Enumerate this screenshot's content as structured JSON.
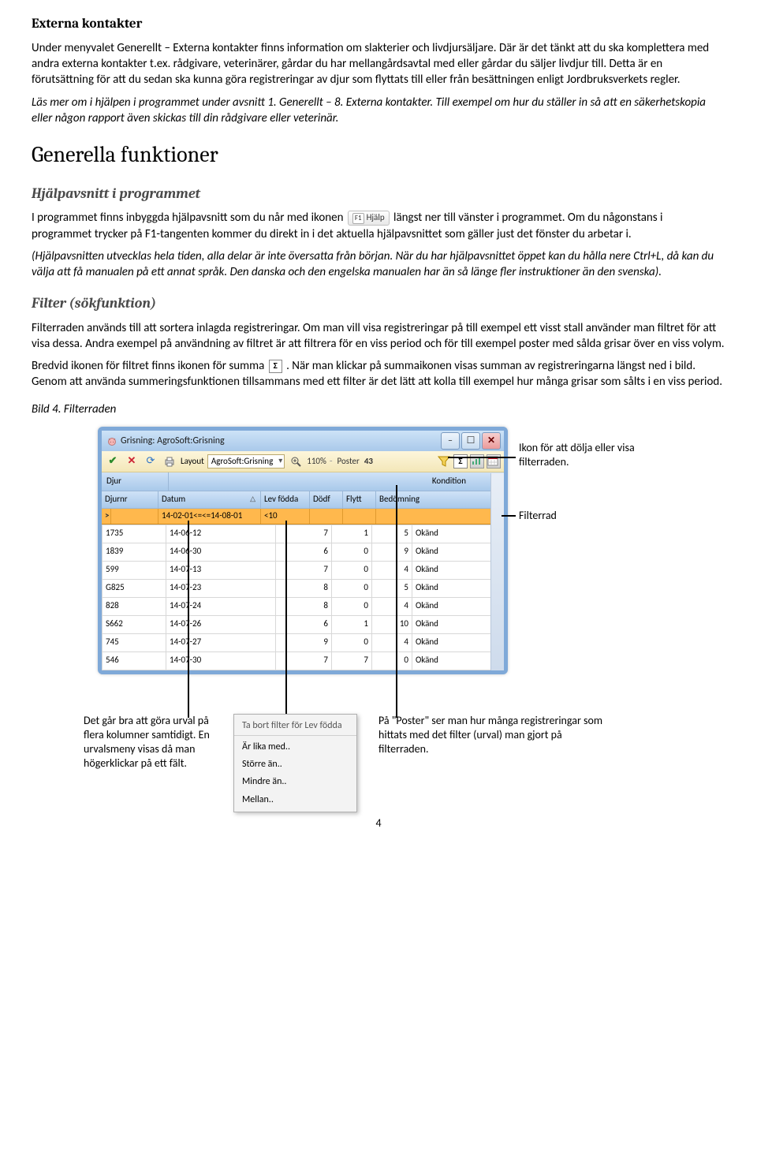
{
  "sections": {
    "h_externa": "Externa kontakter",
    "p1": "Under menyvalet Generellt – Externa kontakter finns information om slakterier och livdjursäljare. Där är det tänkt att du ska komplettera med andra externa kontakter t.ex. rådgivare, veterinärer, gårdar du har mellangårdsavtal med eller gårdar du säljer livdjur till. Detta är en förutsättning för att du sedan ska kunna göra registreringar av djur som flyttats till eller från besättningen enligt Jordbruksverkets regler.",
    "p2": "Läs mer om i hjälpen i programmet under avsnitt 1. Generellt – 8. Externa kontakter. Till exempel om hur du ställer in så att en säkerhetskopia eller någon rapport även skickas till din rådgivare eller veterinär.",
    "h_generella": "Generella funktioner",
    "h_hjalp": "Hjälpavsnitt i programmet",
    "p3a": "I programmet finns inbyggda hjälpavsnitt som du når med ikonen ",
    "p3b": " längst ner till vänster i programmet. Om du någonstans i programmet trycker på F1-tangenten kommer du direkt in i det aktuella hjälpavsnittet som gäller just det fönster du arbetar i.",
    "p4": "(Hjälpavsnitten utvecklas hela tiden, alla delar är inte översatta från början. När du har hjälpavsnittet öppet kan du hålla nere Ctrl+L, då kan du välja att få manualen på ett annat språk. Den danska och den engelska manualen har än så länge fler instruktioner än den svenska).",
    "h_filter": "Filter (sökfunktion)",
    "p5": "Filterraden används till att sortera inlagda registreringar. Om man vill visa registreringar på till exempel ett visst stall använder man filtret för att visa dessa. Andra exempel på användning av filtret är att filtrera för en viss period och för till exempel poster med sålda grisar över en viss volym.",
    "p6a": "Bredvid ikonen för filtret finns ikonen för summa ",
    "p6b": ". När man klickar på summaikonen visas summan av registreringarna längst ned i bild.  Genom att använda summeringsfunktionen tillsammans med ett filter är det lätt att kolla till exempel hur många grisar som sålts i en viss period.",
    "caption": "Bild 4. Filterraden"
  },
  "helpbtn": {
    "key": "F1",
    "label": "Hjälp"
  },
  "sigma_label": "Σ",
  "page": "4",
  "window": {
    "title": "Grisning: AgroSoft:Grisning",
    "toolbar": {
      "layout_label": "Layout",
      "layout_value": "AgroSoft:Grisning",
      "zoom": "110%",
      "poster_label": "Poster",
      "poster_value": "43"
    },
    "band1": {
      "djur": "Djur",
      "kond": "Kondition"
    },
    "headers": {
      "djurnr": "Djurnr",
      "datum": "Datum",
      "lev": "Lev födda",
      "dodf": "Dödf",
      "flytt": "Flytt",
      "bed": "Bedömning"
    },
    "filter": {
      "mark": ">",
      "datum": "14-02-01<=<=14-08-01",
      "lev": "<10"
    },
    "rows": [
      {
        "djurnr": "1735",
        "datum": "14-06-12",
        "lev": "7",
        "dodf": "1",
        "flytt": "5",
        "bed": "Okänd"
      },
      {
        "djurnr": "1839",
        "datum": "14-06-30",
        "lev": "6",
        "dodf": "0",
        "flytt": "9",
        "bed": "Okänd"
      },
      {
        "djurnr": "599",
        "datum": "14-07-13",
        "lev": "7",
        "dodf": "0",
        "flytt": "4",
        "bed": "Okänd"
      },
      {
        "djurnr": "G825",
        "datum": "14-07-23",
        "lev": "8",
        "dodf": "0",
        "flytt": "5",
        "bed": "Okänd"
      },
      {
        "djurnr": "828",
        "datum": "14-07-24",
        "lev": "8",
        "dodf": "0",
        "flytt": "4",
        "bed": "Okänd"
      },
      {
        "djurnr": "S662",
        "datum": "14-07-26",
        "lev": "6",
        "dodf": "1",
        "flytt": "10",
        "bed": "Okänd"
      },
      {
        "djurnr": "745",
        "datum": "14-07-27",
        "lev": "9",
        "dodf": "0",
        "flytt": "4",
        "bed": "Okänd"
      },
      {
        "djurnr": "546",
        "datum": "14-07-30",
        "lev": "7",
        "dodf": "7",
        "flytt": "0",
        "bed": "Okänd"
      }
    ]
  },
  "ctx": {
    "title": "Ta bort filter för Lev födda",
    "items": [
      "Är lika med..",
      "Större än..",
      "Mindre än..",
      "Mellan.."
    ]
  },
  "annot": {
    "a1": "Ikon för att dölja eller visa filterraden.",
    "a2": "Filterrad",
    "a3": "Det går bra att göra urval på flera kolumner samtidigt. En urvalsmeny visas då man högerklickar på ett fält.",
    "a4": "På \"Poster\" ser man hur många registreringar som hittats med det filter (urval) man gjort på filterraden."
  }
}
